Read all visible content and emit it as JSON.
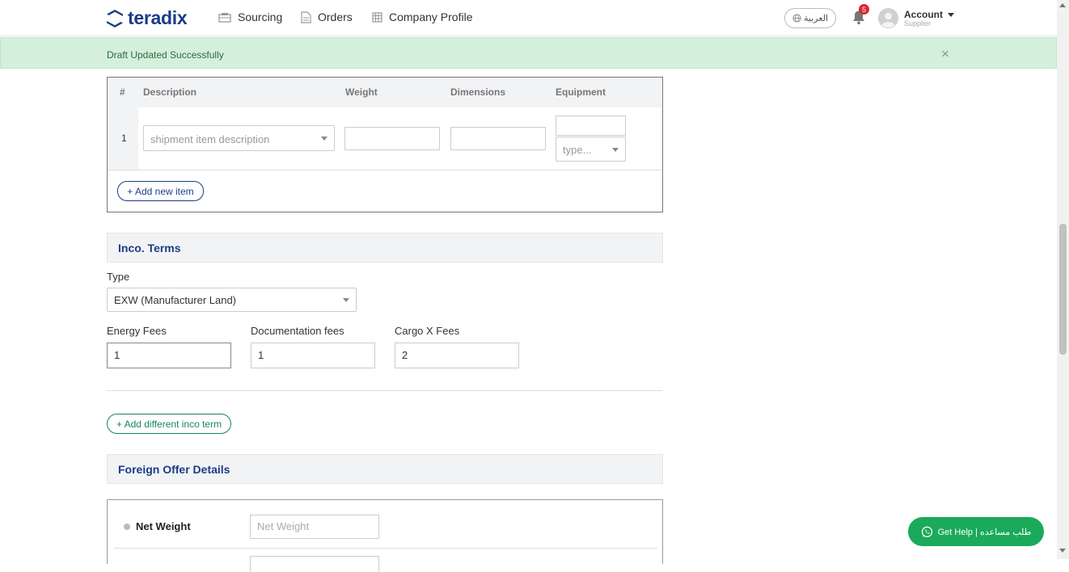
{
  "header": {
    "logo_text": "teradix",
    "nav": [
      {
        "label": "Sourcing",
        "icon": "sourcing-icon"
      },
      {
        "label": "Orders",
        "icon": "document-icon"
      },
      {
        "label": "Company Profile",
        "icon": "building-icon"
      }
    ],
    "language_label": "العربية",
    "notification_count": "5",
    "account_name": "Account",
    "account_role": "Supplier"
  },
  "alert": {
    "message": "Draft Updated Successfully",
    "close_symbol": "×"
  },
  "items_table": {
    "columns": [
      "#",
      "Description",
      "Weight",
      "Dimensions",
      "Equipment"
    ],
    "rows": [
      {
        "number": "1",
        "description_placeholder": "shipment item description",
        "weight": "",
        "dimensions": "",
        "equipment": "",
        "equipment_type_placeholder": "type..."
      }
    ],
    "add_button_label": "+ Add new item"
  },
  "inco_terms": {
    "title": "Inco. Terms",
    "type_label": "Type",
    "type_value": "EXW (Manufacturer Land)",
    "fees": [
      {
        "label": "Energy Fees",
        "value": "1"
      },
      {
        "label": "Documentation fees",
        "value": "1"
      },
      {
        "label": "Cargo X Fees",
        "value": "2"
      }
    ],
    "add_button_label": "+ Add different inco term"
  },
  "foreign_offer": {
    "title": "Foreign Offer Details",
    "net_weight_label": "Net Weight",
    "net_weight_placeholder": "Net Weight"
  },
  "help_button": {
    "label": "Get Help | طلب مساعده"
  },
  "colors": {
    "brand": "#1b3c87",
    "success_bg": "#d4f0dc",
    "help_green": "#1aaa5a",
    "badge_red": "#d9262c"
  }
}
